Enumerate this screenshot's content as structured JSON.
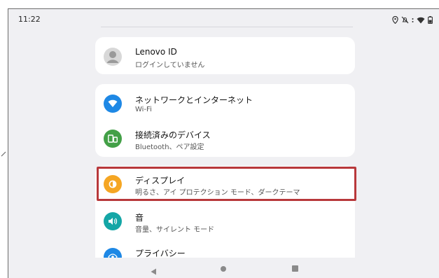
{
  "status_bar": {
    "time": "11:22",
    "icons": [
      "location-icon",
      "mute-icon",
      "wifi-icon",
      "battery-icon"
    ]
  },
  "account": {
    "title": "Lenovo ID",
    "subtitle": "ログインしていません"
  },
  "network_card": [
    {
      "icon": "wifi-icon",
      "color": "#1e88e5",
      "title": "ネットワークとインターネット",
      "subtitle": "Wi-Fi"
    },
    {
      "icon": "devices-icon",
      "color": "#43a047",
      "title": "接続済みのデバイス",
      "subtitle": "Bluetooth、ペア設定"
    }
  ],
  "settings_card": [
    {
      "icon": "display-icon",
      "color": "#f5a623",
      "title": "ディスプレイ",
      "subtitle": "明るさ、アイ プロテクション モード、ダークテーマ"
    },
    {
      "icon": "sound-icon",
      "color": "#14a6a6",
      "title": "音",
      "subtitle": "音量、サイレント モード"
    },
    {
      "icon": "privacy-icon",
      "color": "#1e88e5",
      "title": "プライバシー",
      "subtitle": ""
    }
  ],
  "highlight_color": "#b8383b",
  "nav": [
    "back-icon",
    "home-icon",
    "recents-icon"
  ]
}
